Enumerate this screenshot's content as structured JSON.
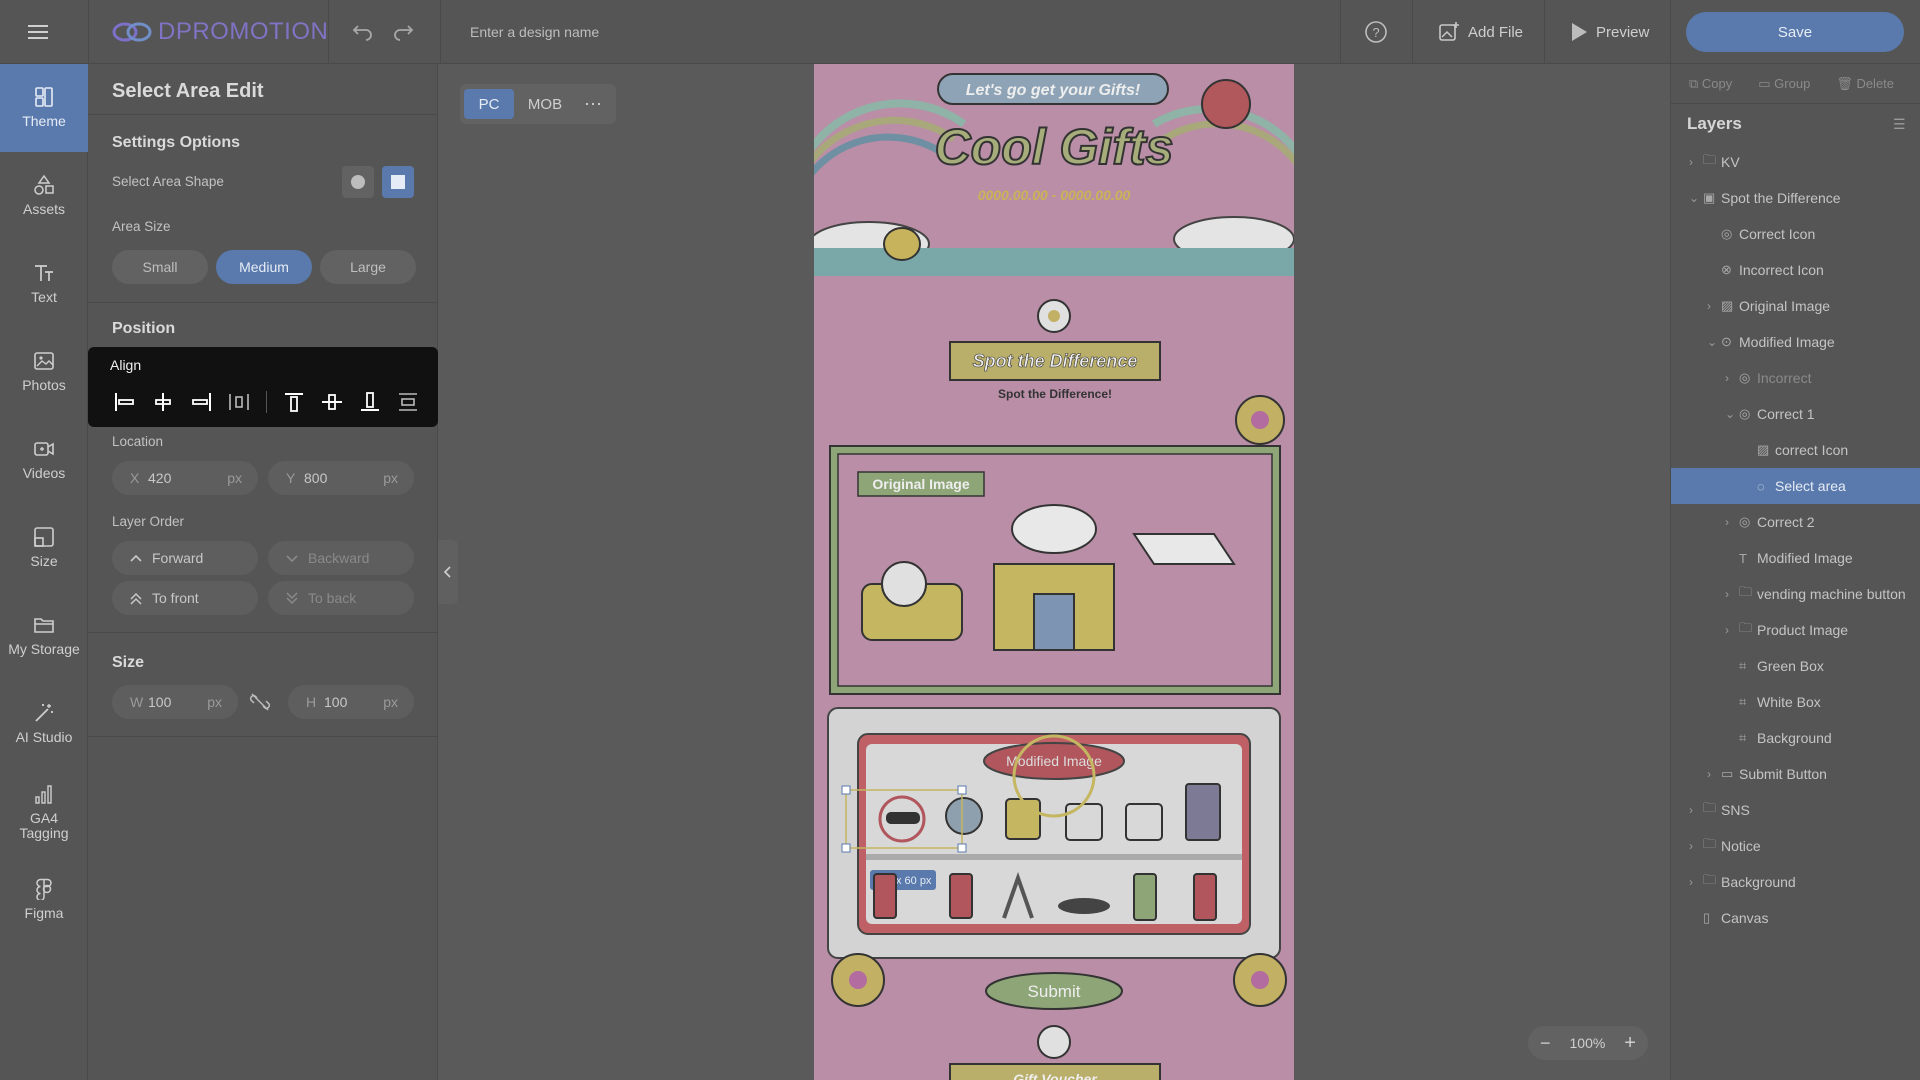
{
  "app": {
    "brand": "DPROMOTION",
    "design_name_placeholder": "Enter a design name",
    "add_file": "Add File",
    "preview": "Preview",
    "save": "Save"
  },
  "nav": [
    {
      "label": "Theme",
      "icon": "theme-icon"
    },
    {
      "label": "Assets",
      "icon": "assets-icon"
    },
    {
      "label": "Text",
      "icon": "text-icon"
    },
    {
      "label": "Photos",
      "icon": "photos-icon"
    },
    {
      "label": "Videos",
      "icon": "videos-icon"
    },
    {
      "label": "Size",
      "icon": "size-icon"
    },
    {
      "label": "My Storage",
      "icon": "folder-icon"
    },
    {
      "label": "AI Studio",
      "icon": "magic-wand-icon"
    },
    {
      "label": "GA4 Tagging",
      "icon": "analytics-icon"
    },
    {
      "label": "Figma",
      "icon": "figma-icon"
    }
  ],
  "panel": {
    "title": "Select Area Edit",
    "settings_title": "Settings Options",
    "shape_label": "Select Area Shape",
    "area_size_label": "Area Size",
    "sizes": [
      "Small",
      "Medium",
      "Large"
    ],
    "selected_size": "Medium",
    "position_title": "Position",
    "align_label": "Align",
    "location_label": "Location",
    "x_key": "X",
    "x_value": "420",
    "y_key": "Y",
    "y_value": "800",
    "unit": "px",
    "layer_order_label": "Layer Order",
    "forward": "Forward",
    "backward": "Backward",
    "to_front": "To front",
    "to_back": "To back",
    "size_title": "Size",
    "w_key": "W",
    "w_value": "100",
    "h_key": "H",
    "h_value": "100"
  },
  "canvas": {
    "device_tabs": [
      "PC",
      "MOB"
    ],
    "active_device": "PC",
    "banner": "Let's go get your Gifts!",
    "headline": "Cool Gifts",
    "date_range": "0000.00.00 - 0000.00.00",
    "spot_title": "Spot the Difference",
    "spot_subtitle": "Spot the Difference!",
    "original_label": "Original Image",
    "modified_label": "Modified Image",
    "selection_size": "120 x 60 px",
    "submit": "Submit",
    "bottom_banner": "Gift Voucher",
    "zoom": "100%"
  },
  "right": {
    "copy": "Copy",
    "group": "Group",
    "delete": "Delete",
    "layers_title": "Layers",
    "layers": [
      {
        "label": "KV",
        "indent": 0,
        "chev": ">",
        "icon": "folder-icon"
      },
      {
        "label": "Spot the Difference",
        "indent": 0,
        "chev": "v",
        "icon": "frame-icon"
      },
      {
        "label": "Correct Icon",
        "indent": 1,
        "chev": "",
        "icon": "target-icon"
      },
      {
        "label": "Incorrect Icon",
        "indent": 1,
        "chev": "",
        "icon": "x-circle-icon"
      },
      {
        "label": "Original Image",
        "indent": 1,
        "chev": ">",
        "icon": "image-icon"
      },
      {
        "label": "Modified Image",
        "indent": 1,
        "chev": "v",
        "icon": "search-icon"
      },
      {
        "label": "Incorrect",
        "indent": 2,
        "chev": ">",
        "icon": "target-icon",
        "dim": true
      },
      {
        "label": "Correct 1",
        "indent": 2,
        "chev": "v",
        "icon": "target-icon"
      },
      {
        "label": "correct Icon",
        "indent": 3,
        "chev": "",
        "icon": "image-icon"
      },
      {
        "label": "Select area",
        "indent": 3,
        "chev": "",
        "icon": "dashed-circle-icon",
        "selected": true
      },
      {
        "label": "Correct 2",
        "indent": 2,
        "chev": ">",
        "icon": "target-icon"
      },
      {
        "label": "Modified Image",
        "indent": 2,
        "chev": "",
        "icon": "text-icon"
      },
      {
        "label": "vending machine button",
        "indent": 2,
        "chev": ">",
        "icon": "folder-icon"
      },
      {
        "label": "Product Image",
        "indent": 2,
        "chev": ">",
        "icon": "folder-icon"
      },
      {
        "label": "Green Box",
        "indent": 2,
        "chev": "",
        "icon": "shape-icon"
      },
      {
        "label": "White Box",
        "indent": 2,
        "chev": "",
        "icon": "shape-icon"
      },
      {
        "label": "Background",
        "indent": 2,
        "chev": "",
        "icon": "shape-icon"
      },
      {
        "label": "Submit Button",
        "indent": 1,
        "chev": ">",
        "icon": "button-icon"
      },
      {
        "label": "SNS",
        "indent": 0,
        "chev": ">",
        "icon": "folder-icon"
      },
      {
        "label": "Notice",
        "indent": 0,
        "chev": ">",
        "icon": "folder-icon"
      },
      {
        "label": "Background",
        "indent": 0,
        "chev": ">",
        "icon": "folder-icon"
      },
      {
        "label": "Canvas",
        "indent": 0,
        "chev": "",
        "icon": "canvas-icon"
      }
    ]
  }
}
